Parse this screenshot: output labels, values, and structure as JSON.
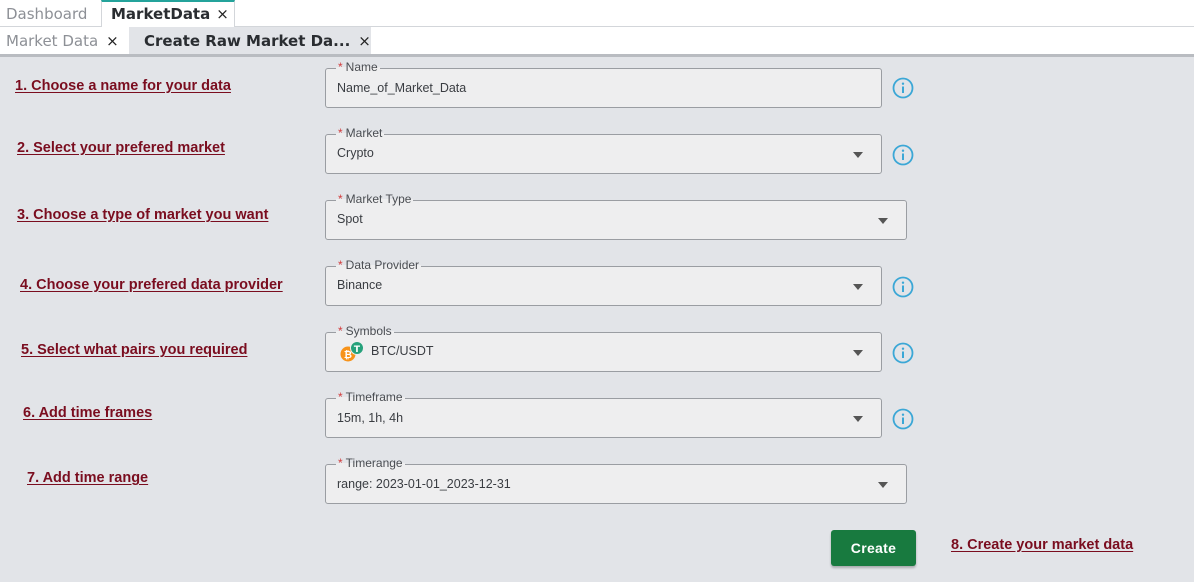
{
  "tabs_top": [
    {
      "label": "Dashboard"
    },
    {
      "label": "MarketData",
      "close": "×"
    }
  ],
  "tabs_sub": [
    {
      "label": "Market Data",
      "close": "×"
    },
    {
      "label": "Create Raw Market Da...",
      "close": "×"
    }
  ],
  "steps": {
    "s1": "1. Choose a name for your data",
    "s2": "2. Select your prefered market",
    "s3": "3. Choose a type of market you want",
    "s4": "4. Choose your prefered data provider",
    "s5": "5. Select what pairs you required",
    "s6": "6. Add time frames",
    "s7": "7. Add time range",
    "s8": "8. Create your market data"
  },
  "form": {
    "required_mark": "*",
    "name": {
      "label": "Name",
      "value": "Name_of_Market_Data"
    },
    "market": {
      "label": "Market",
      "value": "Crypto"
    },
    "market_type": {
      "label": "Market Type",
      "value": "Spot"
    },
    "data_provider": {
      "label": "Data Provider",
      "value": "Binance"
    },
    "symbols": {
      "label": "Symbols",
      "value": "BTC/USDT"
    },
    "timeframe": {
      "label": "Timeframe",
      "value": "15m, 1h, 4h"
    },
    "timerange": {
      "label": "Timerange",
      "value": "range: 2023-01-01_2023-12-31"
    }
  },
  "create_button": "Create",
  "icons": {
    "info": "info-icon",
    "dropdown": "chevron-down-icon",
    "crypto_pair": "btc-usdt-icon"
  },
  "colors": {
    "step_text": "#7a0d1f",
    "create_button": "#187a3f",
    "tab_accent": "#24a39b",
    "info_icon": "#3ba7d6",
    "required": "#d33b3b"
  }
}
